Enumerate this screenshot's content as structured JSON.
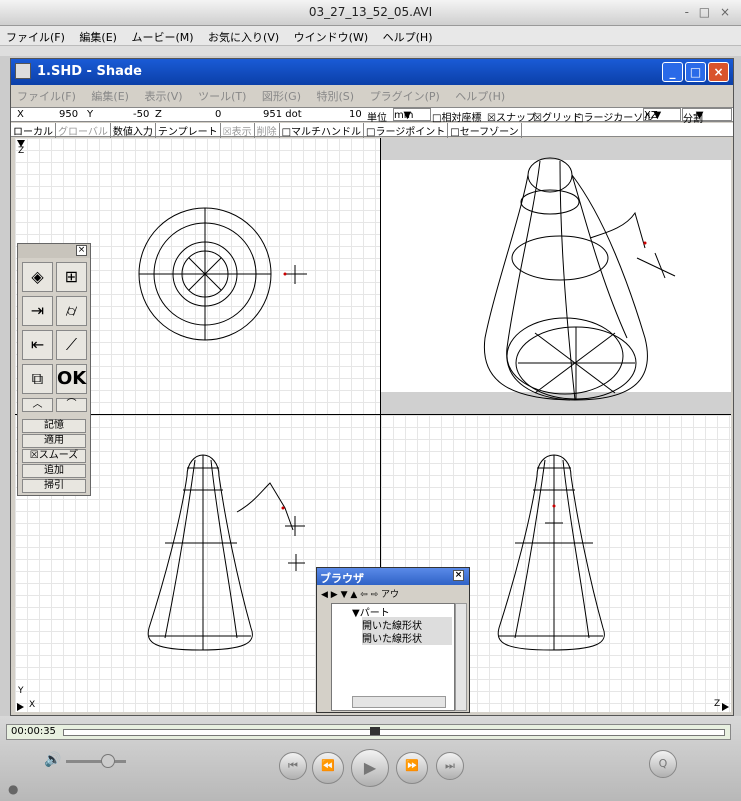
{
  "player": {
    "title": "03_27_13_52_05.AVI",
    "window_controls": "- □ ×",
    "menu": [
      "ファイル(F)",
      "編集(E)",
      "ムービー(M)",
      "お気に入り(V)",
      "ウインドウ(W)",
      "ヘルプ(H)"
    ],
    "timecode": "00:00:35",
    "progress": 0.47,
    "volume": 0.7
  },
  "shade": {
    "title": "1.SHD - Shade",
    "menu": [
      "ファイル(F)",
      "編集(E)",
      "表示(V)",
      "ツール(T)",
      "図形(G)",
      "特別(S)",
      "プラグイン(P)",
      "ヘルプ(H)"
    ],
    "coords": {
      "x_label": "X",
      "x_value": "950",
      "y_label": "Y",
      "y_value": "-50",
      "z_label": "Z",
      "z_value": "0",
      "dot_value": "951 dot",
      "num": "10",
      "unit_label": "単位",
      "unit_value": "mm",
      "relative": "□相対座標",
      "snap": "☒スナップ",
      "grid": "☒グリッド",
      "large_cursor": "□ラージカーソル",
      "plane": "XZ",
      "split": "分割"
    },
    "toolbar2": {
      "local": "ローカル",
      "global": "グローバル",
      "numeric": "数値入力",
      "template": "テンプレート",
      "display": "☒表示",
      "delete": "削除",
      "multi_handle": "□マルチハンドル",
      "large_point": "□ラージポイント",
      "safe_zone": "□セーフゾーン"
    },
    "view_axes": {
      "z": "Z",
      "y": "Y",
      "x": "X",
      "z2": "Z"
    }
  },
  "tool_palette": {
    "ok_label": "OK",
    "buttons": [
      "記憶",
      "適用",
      "☒スムーズ",
      "追加",
      "掃引"
    ]
  },
  "browser": {
    "title": "ブラウザ",
    "tab": "アウ",
    "tree_root": "▼パート",
    "items": [
      "開いた線形状",
      "開いた線形状"
    ]
  }
}
